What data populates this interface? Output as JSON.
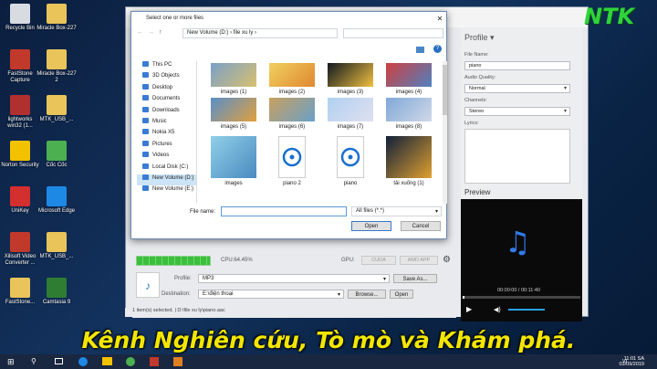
{
  "desktop_icons": [
    {
      "label": "Recycle Bin",
      "color": "#d7dce2"
    },
    {
      "label": "Miracle Box-227",
      "color": "#e8c45a"
    },
    {
      "label": "FastStone Capture",
      "color": "#c0392b"
    },
    {
      "label": "Miracle Box-227 2",
      "color": "#e8c45a"
    },
    {
      "label": "lightworks win32 (1...",
      "color": "#b03030"
    },
    {
      "label": "MTK_USB_...",
      "color": "#e8c45a"
    },
    {
      "label": "Norton Security",
      "color": "#f2c200"
    },
    {
      "label": "Cốc Cốc",
      "color": "#4caf50"
    },
    {
      "label": "UniKey",
      "color": "#d32f2f"
    },
    {
      "label": "Microsoft Edge",
      "color": "#1e88e5"
    },
    {
      "label": "Xilisoft Video Converter ...",
      "color": "#c0392b"
    },
    {
      "label": "MTK_USB_...",
      "color": "#e8c45a"
    },
    {
      "label": "FastStone...",
      "color": "#e8c45a"
    },
    {
      "label": "Camtasia 9",
      "color": "#2e7d32"
    }
  ],
  "dialog": {
    "title": "Select one or more files",
    "close_glyph": "✕",
    "address": "New Volume (D:)  ›  file xu ly  ›",
    "nav_items": [
      "This PC",
      "3D Objects",
      "Desktop",
      "Documents",
      "Downloads",
      "Music",
      "Nokia X5",
      "Pictures",
      "Videos",
      "Local Disk (C:)",
      "New Volume (D:)",
      "New Volume (E:)"
    ],
    "files": [
      {
        "name": "images (1)",
        "c1": "#7aa0c8",
        "c2": "#d8c070"
      },
      {
        "name": "images (2)",
        "c1": "#f0d060",
        "c2": "#e08830"
      },
      {
        "name": "images (3)",
        "c1": "#101820",
        "c2": "#f0c040"
      },
      {
        "name": "images (4)",
        "c1": "#d04040",
        "c2": "#5080c0"
      },
      {
        "name": "images (5)",
        "c1": "#5a8fc8",
        "c2": "#e0a040"
      },
      {
        "name": "images (6)",
        "c1": "#c8a060",
        "c2": "#6aa0c8"
      },
      {
        "name": "images (7)",
        "c1": "#b0d0f0",
        "c2": "#e0e0f0"
      },
      {
        "name": "images (8)",
        "c1": "#80a8d8",
        "c2": "#d0d8e8"
      },
      {
        "name": "images",
        "c1": "#90d0e8",
        "c2": "#4a8ac0"
      },
      {
        "name": "piano 2",
        "c1": "#ffffff",
        "c2": "#ffffff"
      },
      {
        "name": "piano",
        "c1": "#ffffff",
        "c2": "#ffffff"
      },
      {
        "name": "tải xuống (1)",
        "c1": "#10203a",
        "c2": "#e0a030"
      }
    ],
    "filename_label": "File name:",
    "filename_value": "",
    "filetype": "All files (*.*)",
    "open_label": "Open",
    "cancel_label": "Cancel"
  },
  "app": {
    "profile_header": "Profile",
    "file_name_label": "File Name:",
    "file_name_value": "piano",
    "audio_quality_label": "Audio Quality:",
    "audio_quality_value": "Normal",
    "channels_label": "Channels:",
    "channels_value": "Stereo",
    "lyrics_label": "Lyrics:",
    "preview_header": "Preview",
    "preview_time": "00:00:00 / 00:11:40",
    "cpu": "CPU:64.45%",
    "gpu": "GPU:",
    "cuda": "CUDA",
    "amd": "AMD APP",
    "profile_label": "Profile:",
    "profile_value": "MP3",
    "save_as": "Save As...",
    "destination_label": "Destination:",
    "destination_value": "E:\\điện thoại",
    "browse": "Browse...",
    "open": "Open",
    "status": "1 item(s) selected. | D:\\file xu ly\\piano.aac",
    "progress": 1.0
  },
  "overlay": {
    "brand": "NTK",
    "caption": "Kênh Nghiên cứu, Tò mò và Khám phá."
  },
  "taskbar": {
    "time": "11:01 SA",
    "date": "03/09/2019",
    "lang": "VI"
  }
}
